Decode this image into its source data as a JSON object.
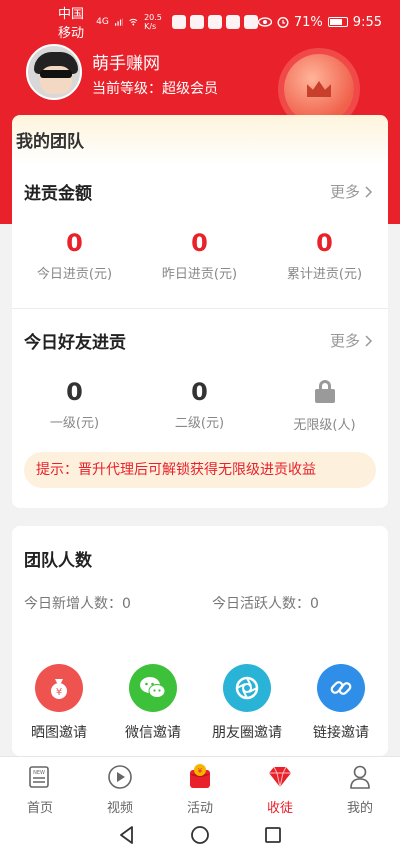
{
  "status_bar": {
    "carrier": "中国移动",
    "network": "4G",
    "speed": "20.5 K/s",
    "battery": "71%",
    "time": "9:55"
  },
  "profile": {
    "username": "萌手赚网",
    "level_text": "当前等级：超级会员"
  },
  "team": {
    "title": "我的团队",
    "contribution": {
      "title": "进贡金额",
      "more": "更多",
      "stats": [
        {
          "value": "0",
          "label": "今日进贡(元)"
        },
        {
          "value": "0",
          "label": "昨日进贡(元)"
        },
        {
          "value": "0",
          "label": "累计进贡(元)"
        }
      ]
    },
    "friends": {
      "title": "今日好友进贡",
      "more": "更多",
      "stats": [
        {
          "value": "0",
          "label": "一级(元)"
        },
        {
          "value": "0",
          "label": "二级(元)"
        },
        {
          "label": "无限级(人)"
        }
      ]
    },
    "tip": "提示：晋升代理后可解锁获得无限级进贡收益"
  },
  "team_count": {
    "title": "团队人数",
    "new_today": "今日新增人数：0",
    "active_today": "今日活跃人数：0",
    "invites": [
      {
        "label": "晒图邀请",
        "icon": "money-bag-icon",
        "color": "#ef5350"
      },
      {
        "label": "微信邀请",
        "icon": "wechat-icon",
        "color": "#3ec13a"
      },
      {
        "label": "朋友圈邀请",
        "icon": "moments-icon",
        "color": "#29b3d6"
      },
      {
        "label": "链接邀请",
        "icon": "link-icon",
        "color": "#2f8fe8"
      }
    ]
  },
  "tabs": [
    {
      "label": "首页",
      "icon": "news-icon"
    },
    {
      "label": "视频",
      "icon": "play-icon"
    },
    {
      "label": "活动",
      "icon": "red-packet-icon"
    },
    {
      "label": "收徒",
      "icon": "diamond-icon",
      "active": true
    },
    {
      "label": "我的",
      "icon": "user-icon"
    }
  ],
  "colors": {
    "brand_red": "#e8212a",
    "tip_bg": "#fdf1de"
  }
}
